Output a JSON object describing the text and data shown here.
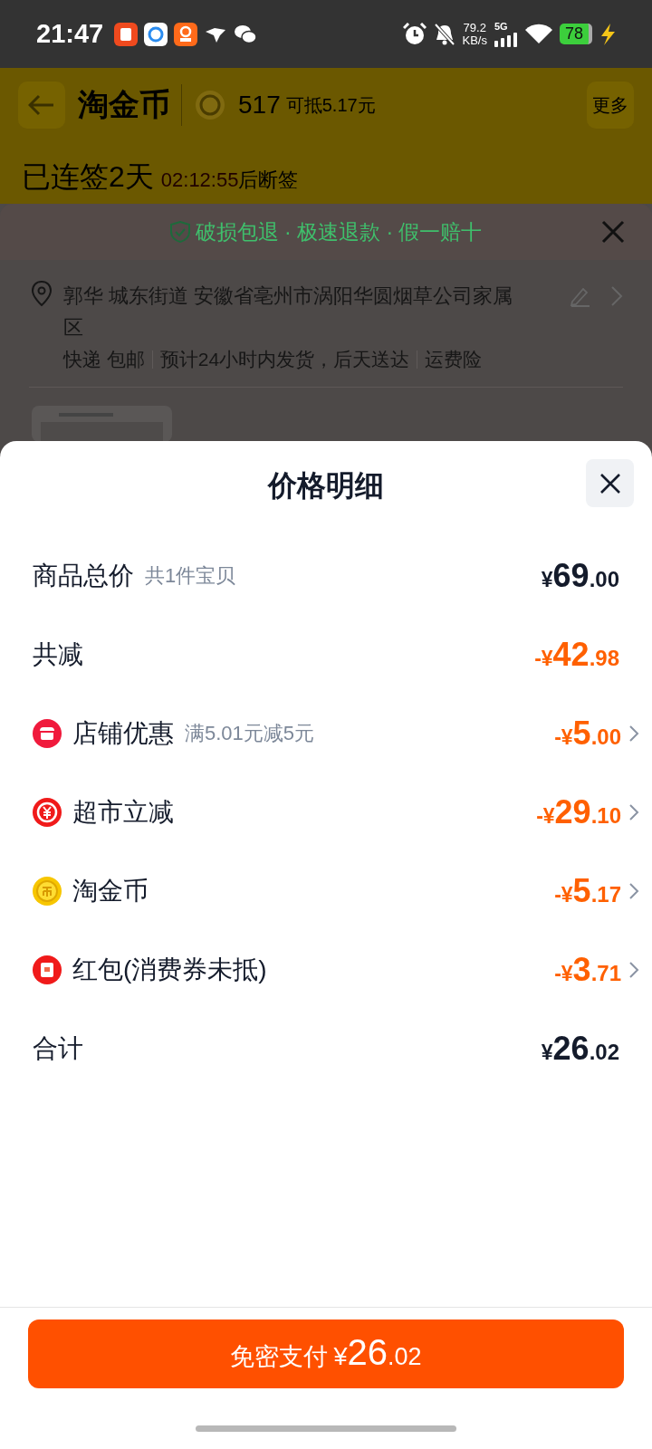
{
  "status_bar": {
    "time": "21:47",
    "net_speed": "79.2",
    "net_unit": "KB/s",
    "network": "5G",
    "battery": "78"
  },
  "background_page": {
    "header": {
      "title": "淘金币",
      "coins": "517",
      "coins_note": "可抵5.17元",
      "more_button": "更多"
    },
    "checkin": {
      "label": "已连签2天",
      "countdown": "02:12:55",
      "suffix": "后断签"
    },
    "order_panel": {
      "guarantee": "破损包退 · 极速退款 · 假一赔十",
      "address": "郭华 城东街道 安徽省亳州市涡阳华圆烟草公司家属区",
      "delivery": [
        "快递 包邮",
        "预计24小时内发货，后天送达",
        "运费险"
      ]
    }
  },
  "price_sheet": {
    "title": "价格明细",
    "rows": [
      {
        "kind": "summary",
        "label": "商品总价",
        "note": "共1件宝贝",
        "amount": "¥69.00"
      },
      {
        "kind": "reduction",
        "label": "共减",
        "amount": "-¥42.98"
      },
      {
        "kind": "discount",
        "label": "店铺优惠",
        "note": "满5.01元减5元",
        "amount": "-¥5.00"
      },
      {
        "kind": "discount",
        "label": "超市立减",
        "amount": "-¥29.10"
      },
      {
        "kind": "discount",
        "label": "淘金币",
        "amount": "-¥5.17"
      },
      {
        "kind": "discount",
        "label": "红包(消费券未抵)",
        "amount": "-¥3.71"
      },
      {
        "kind": "summary",
        "label": "合计",
        "amount": "¥26.02"
      }
    ],
    "pay_button": {
      "label": "免密支付",
      "amount": "¥26.02"
    }
  }
}
